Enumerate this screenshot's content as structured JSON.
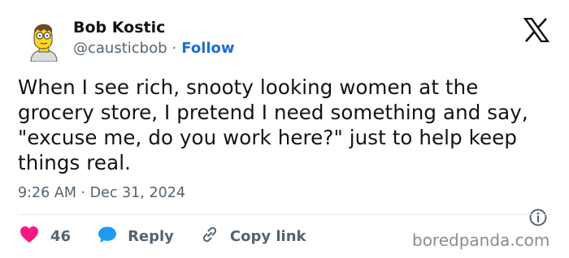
{
  "author": {
    "display_name": "Bob Kostic",
    "handle": "@causticbob",
    "separator": "·",
    "follow_label": "Follow",
    "avatar_icon": "simpsons-style-avatar"
  },
  "tweet": {
    "text": "When I see rich, snooty looking women at the\ngrocery store, I pretend I need something and say,\n\"excuse me, do you work here?\" just to help keep\nthings real.",
    "timestamp": "9:26 AM · Dec 31, 2024"
  },
  "actions": {
    "like_count": "46",
    "reply_label": "Reply",
    "copy_link_label": "Copy link"
  },
  "icons": {
    "logo": "x-logo-icon",
    "info": "info-icon",
    "heart": "heart-icon",
    "reply": "reply-bubble-icon",
    "link": "link-icon"
  },
  "colors": {
    "follow": "#1d6fd1",
    "heart": "#f91880",
    "reply": "#1d9bf0",
    "muted": "#536471"
  },
  "watermark": "boredpanda.com"
}
